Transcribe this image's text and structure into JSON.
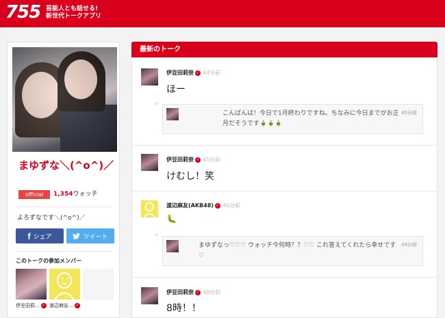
{
  "header": {
    "logo_text": "755",
    "tagline_line1": "芸能人とも話せる!",
    "tagline_line2": "新世代トークアプリ",
    "brand_color": "#d9001b"
  },
  "room": {
    "name": "まゆずな＼(^o^)／",
    "official_label": "official",
    "watch_count": "1,354",
    "watch_suffix": "ウォッチ",
    "description": "よろずなです＼(^o^)／",
    "share_facebook": "シェア",
    "share_twitter": "ツイート",
    "members_title": "このトークの参加メンバー",
    "members": [
      {
        "label": "伊豆田莉...",
        "icon": "member-photo"
      },
      {
        "label": "渡辺麻友...",
        "icon": "member-illustration"
      }
    ]
  },
  "feed": {
    "title": "最新のトーク",
    "posts": [
      {
        "poster": "伊豆田莉奈",
        "time": "44分前",
        "body": "ほー",
        "reply": {
          "text": "こんばんは！今日で1月終わりですね。ちなみに今日までがお正月だそうです🎍🎍🎍",
          "time": "45分前"
        }
      },
      {
        "poster": "伊豆田莉奈",
        "time": "45分前",
        "body": "けむし！笑"
      },
      {
        "poster": "渡辺麻友(AKB48)",
        "time": "46分前",
        "body": "🐛",
        "reply": {
          "text": "まゆずなっ♡♡♡ ウォッチ今何時？？♡♡ これ答えてくれたら幸せです♡",
          "time": "49分前"
        }
      },
      {
        "poster": "伊豆田莉奈",
        "time": "48分前",
        "body": "8時！！"
      }
    ]
  }
}
